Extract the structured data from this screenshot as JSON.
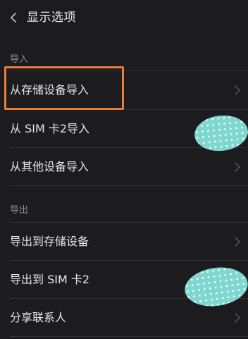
{
  "header": {
    "back_icon": "chevron-left-icon",
    "title": "显示选项"
  },
  "sections": {
    "import": {
      "label": "导入",
      "items": [
        {
          "label": "从存储设备导入",
          "chevron": "chevron-right-icon"
        },
        {
          "label": "从 SIM 卡2导入",
          "chevron": "chevron-right-icon"
        },
        {
          "label": "从其他设备导入",
          "chevron": "chevron-right-icon"
        }
      ]
    },
    "export": {
      "label": "导出",
      "items": [
        {
          "label": "导出到存储设备",
          "chevron": "chevron-right-icon"
        },
        {
          "label": "导出到 SIM 卡2",
          "chevron": "chevron-right-icon"
        },
        {
          "label": "分享联系人",
          "chevron": "chevron-right-icon"
        }
      ]
    }
  },
  "colors": {
    "background": "#1c1c1e",
    "highlight": "#f07a3a",
    "redaction": "#7fd7cf"
  }
}
